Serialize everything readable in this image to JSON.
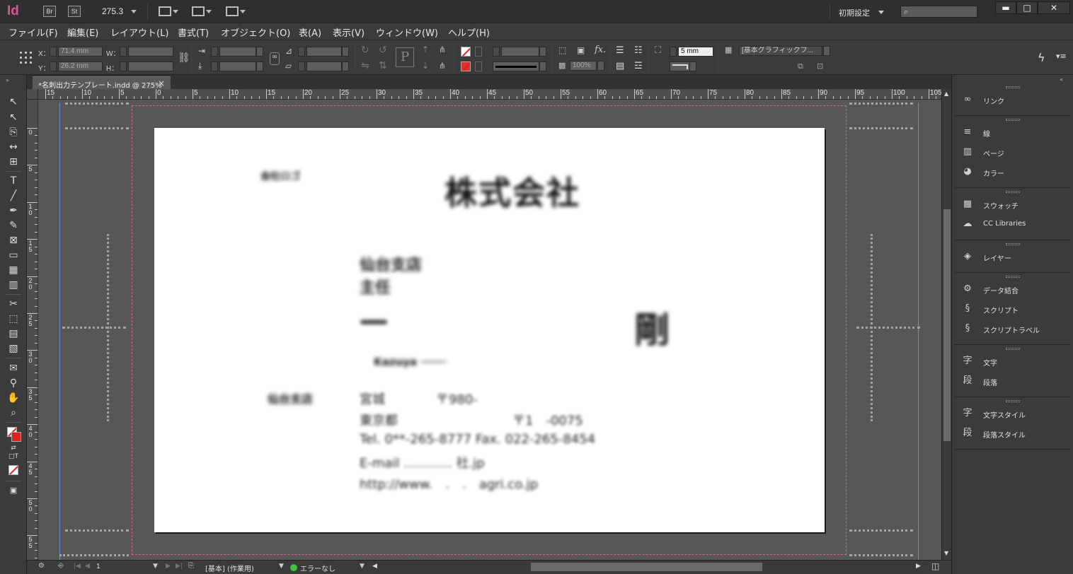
{
  "app": {
    "logo": "Id",
    "bridge_badge": "Br",
    "stock_badge": "St",
    "zoom_value": "275.3",
    "workspace": "初期設定",
    "window_controls": [
      "▬",
      "□",
      "✕"
    ]
  },
  "menu": [
    "ファイル(F)",
    "編集(E)",
    "レイアウト(L)",
    "書式(T)",
    "オブジェクト(O)",
    "表(A)",
    "表示(V)",
    "ウィンドウ(W)",
    "ヘルプ(H)"
  ],
  "control": {
    "x_label": "X：",
    "x_value": "71.4 mm",
    "y_label": "Y：",
    "y_value": "26.2 mm",
    "w_label": "W：",
    "h_label": "H：",
    "stroke_weight": "5 mm",
    "opacity": "100%",
    "object_style": "[基本グラフィックフ..."
  },
  "document": {
    "tab_title": "*名刺出力テンプレート.indd @ 275%",
    "close_glyph": "×"
  },
  "ruler": {
    "h_labels": [
      "15",
      "10",
      "5",
      "0",
      "5",
      "10",
      "15",
      "20",
      "25",
      "30",
      "35",
      "40",
      "45",
      "50",
      "55",
      "60",
      "65",
      "70",
      "75",
      "80",
      "85",
      "90",
      "95",
      "100",
      "105"
    ],
    "v_labels": [
      [
        "0"
      ],
      [
        "5"
      ],
      [
        "1",
        "0"
      ],
      [
        "1",
        "5"
      ],
      [
        "2",
        "0"
      ],
      [
        "2",
        "5"
      ],
      [
        "3",
        "0"
      ],
      [
        "3",
        "5"
      ],
      [
        "4",
        "0"
      ],
      [
        "4",
        "5"
      ],
      [
        "5",
        "0"
      ],
      [
        "5",
        "5"
      ]
    ]
  },
  "card": {
    "small_logo": "会社ロゴ",
    "company": "株式会社",
    "branch": "仙台支店",
    "position": "主任",
    "name_left": "━━",
    "name_right": "剛",
    "name_roman": "Kazuya  ────",
    "office_label": "仙台支店",
    "address_1": "宮城　　　　〒980-",
    "address_2": "東京都　　　　　　　　　〒1　-0075",
    "phone_fax": "Tel. 0**-265-8777   Fax. 022-265-8454",
    "email": "E-mail ............ 社.jp",
    "url": "http://www.　.　.　agri.co.jp"
  },
  "panels": [
    {
      "items": [
        {
          "icon": "link-icon",
          "glyph": "∞",
          "label": "リンク"
        }
      ]
    },
    {
      "items": [
        {
          "icon": "stroke-icon",
          "glyph": "≡",
          "label": "線"
        },
        {
          "icon": "pages-icon",
          "glyph": "▥",
          "label": "ページ"
        },
        {
          "icon": "color-icon",
          "glyph": "◕",
          "label": "カラー"
        }
      ]
    },
    {
      "items": [
        {
          "icon": "swatches-icon",
          "glyph": "▦",
          "label": "スウォッチ"
        },
        {
          "icon": "cc-libraries-icon",
          "glyph": "☁",
          "label": "CC Libraries"
        }
      ]
    },
    {
      "items": [
        {
          "icon": "layers-icon",
          "glyph": "◈",
          "label": "レイヤー"
        }
      ]
    },
    {
      "items": [
        {
          "icon": "data-merge-icon",
          "glyph": "⚙",
          "label": "データ結合"
        },
        {
          "icon": "scripts-icon",
          "glyph": "§",
          "label": "スクリプト"
        },
        {
          "icon": "script-label-icon",
          "glyph": "§",
          "label": "スクリプトラベル"
        }
      ]
    },
    {
      "items": [
        {
          "icon": "character-icon",
          "glyph": "字",
          "label": "文字"
        },
        {
          "icon": "paragraph-icon",
          "glyph": "段",
          "label": "段落"
        }
      ]
    },
    {
      "items": [
        {
          "icon": "character-styles-icon",
          "glyph": "字",
          "label": "文字スタイル"
        },
        {
          "icon": "paragraph-styles-icon",
          "glyph": "段",
          "label": "段落スタイル"
        }
      ]
    }
  ],
  "status": {
    "page_number": "1",
    "master": "[基本] (作業用)",
    "preflight": "エラーなし"
  },
  "colors": {
    "indesign_brand": "#e0528f",
    "preflight_ok": "#3ec43e",
    "bleed_guide": "#d96b85",
    "slug_guide": "#6c8dd8"
  }
}
